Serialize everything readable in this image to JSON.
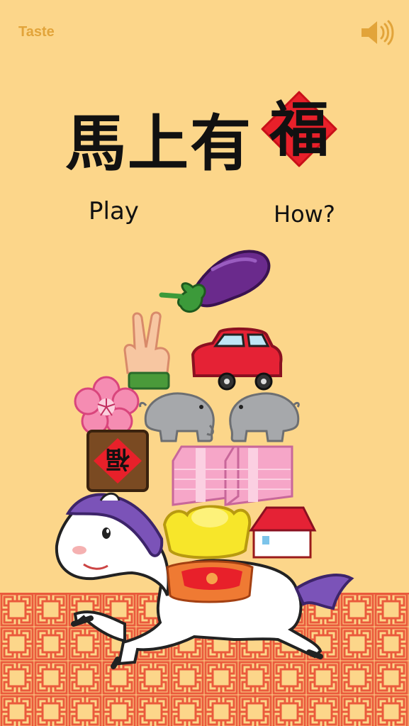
{
  "header": {
    "taste_label": "Taste",
    "sound_icon": "speaker-icon"
  },
  "title": {
    "text": "馬上有",
    "fu_char": "福"
  },
  "menu": {
    "play_label": "Play",
    "how_label": "How?"
  },
  "scene": {
    "fu_block_char": "福",
    "items": [
      "eggplant",
      "peace-hand",
      "car",
      "plum-blossom",
      "elephants",
      "fu-block",
      "money-stacks",
      "gold-ingot",
      "house",
      "horse"
    ]
  },
  "colors": {
    "background": "#fcd68a",
    "lattice": "#ea5a3c",
    "accent_red": "#e8202a",
    "taste_gold": "#e2a43a"
  }
}
